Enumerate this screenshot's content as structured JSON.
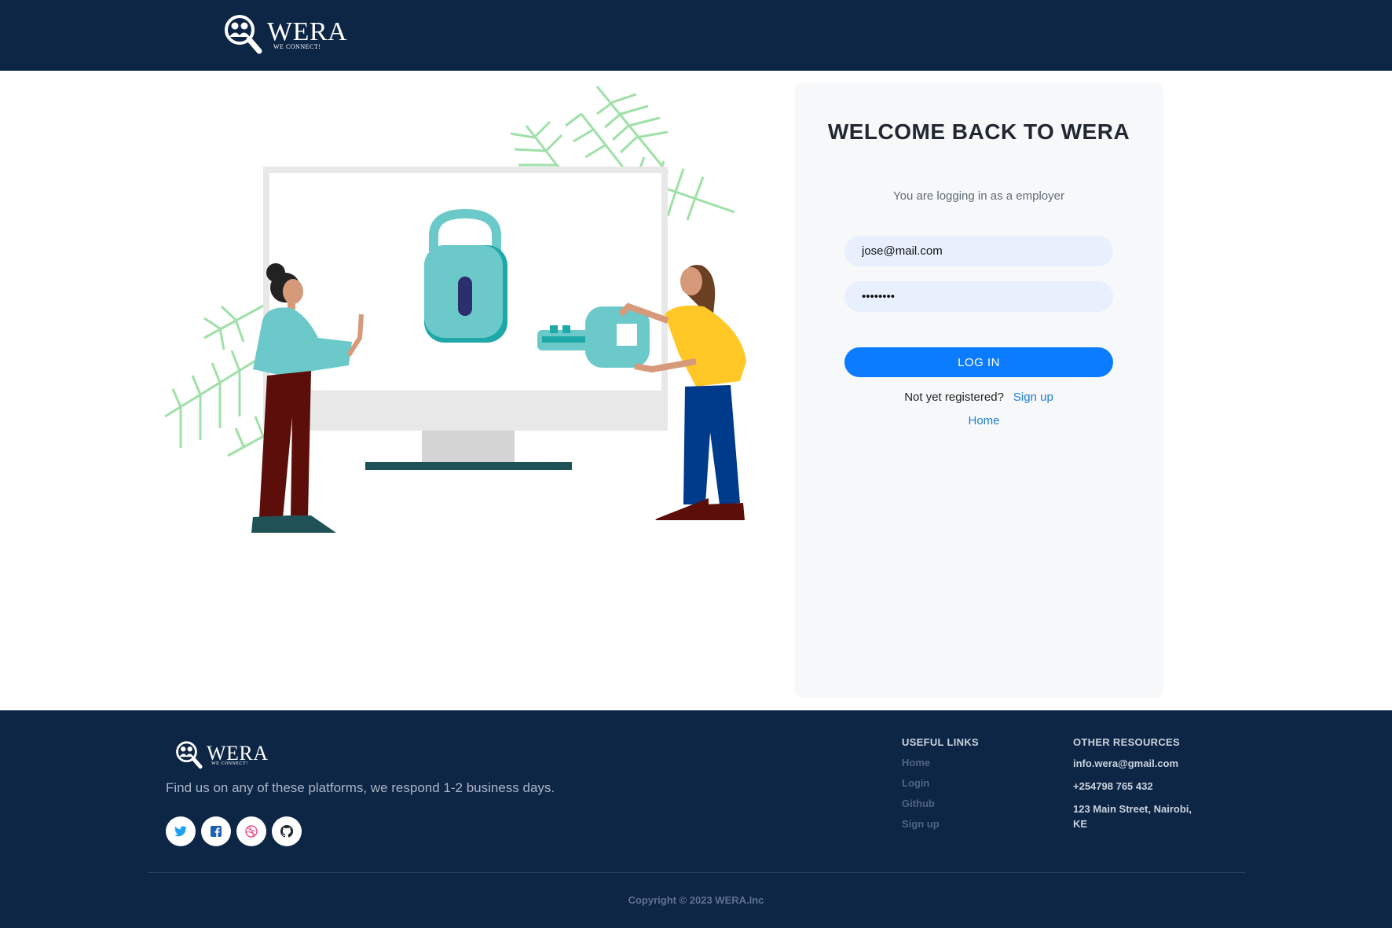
{
  "header": {
    "brand_name": "WERA",
    "brand_tagline": "WE CONNECT!"
  },
  "login": {
    "title": "WELCOME BACK TO WERA",
    "subtitle": "You are logging in as a employer",
    "email_value": "jose@mail.com",
    "password_value": "••••••••",
    "login_button": "LOG IN",
    "not_registered": "Not yet registered?",
    "signup_link": "Sign up",
    "home_link": "Home"
  },
  "footer": {
    "brand_name": "WERA",
    "brand_tagline": "WE CONNECT!",
    "blurb": "Find us on any of these platforms, we respond 1-2 business days.",
    "socials": [
      "twitter-icon",
      "facebook-icon",
      "dribbble-icon",
      "github-icon"
    ],
    "useful_links_title": "USEFUL LINKS",
    "useful_links": [
      "Home",
      "Login",
      "Github",
      "Sign up"
    ],
    "resources_title": "OTHER RESOURCES",
    "resources": [
      "info.wera@gmail.com",
      "+254798 765 432",
      "123 Main Street, Nairobi, KE"
    ],
    "copyright": "Copyright © 2023 WERA.Inc"
  },
  "colors": {
    "navy": "#0e2646",
    "accent_blue": "#0b7bff",
    "link_blue": "#1c7dd6",
    "input_bg": "#e8f0fe"
  }
}
